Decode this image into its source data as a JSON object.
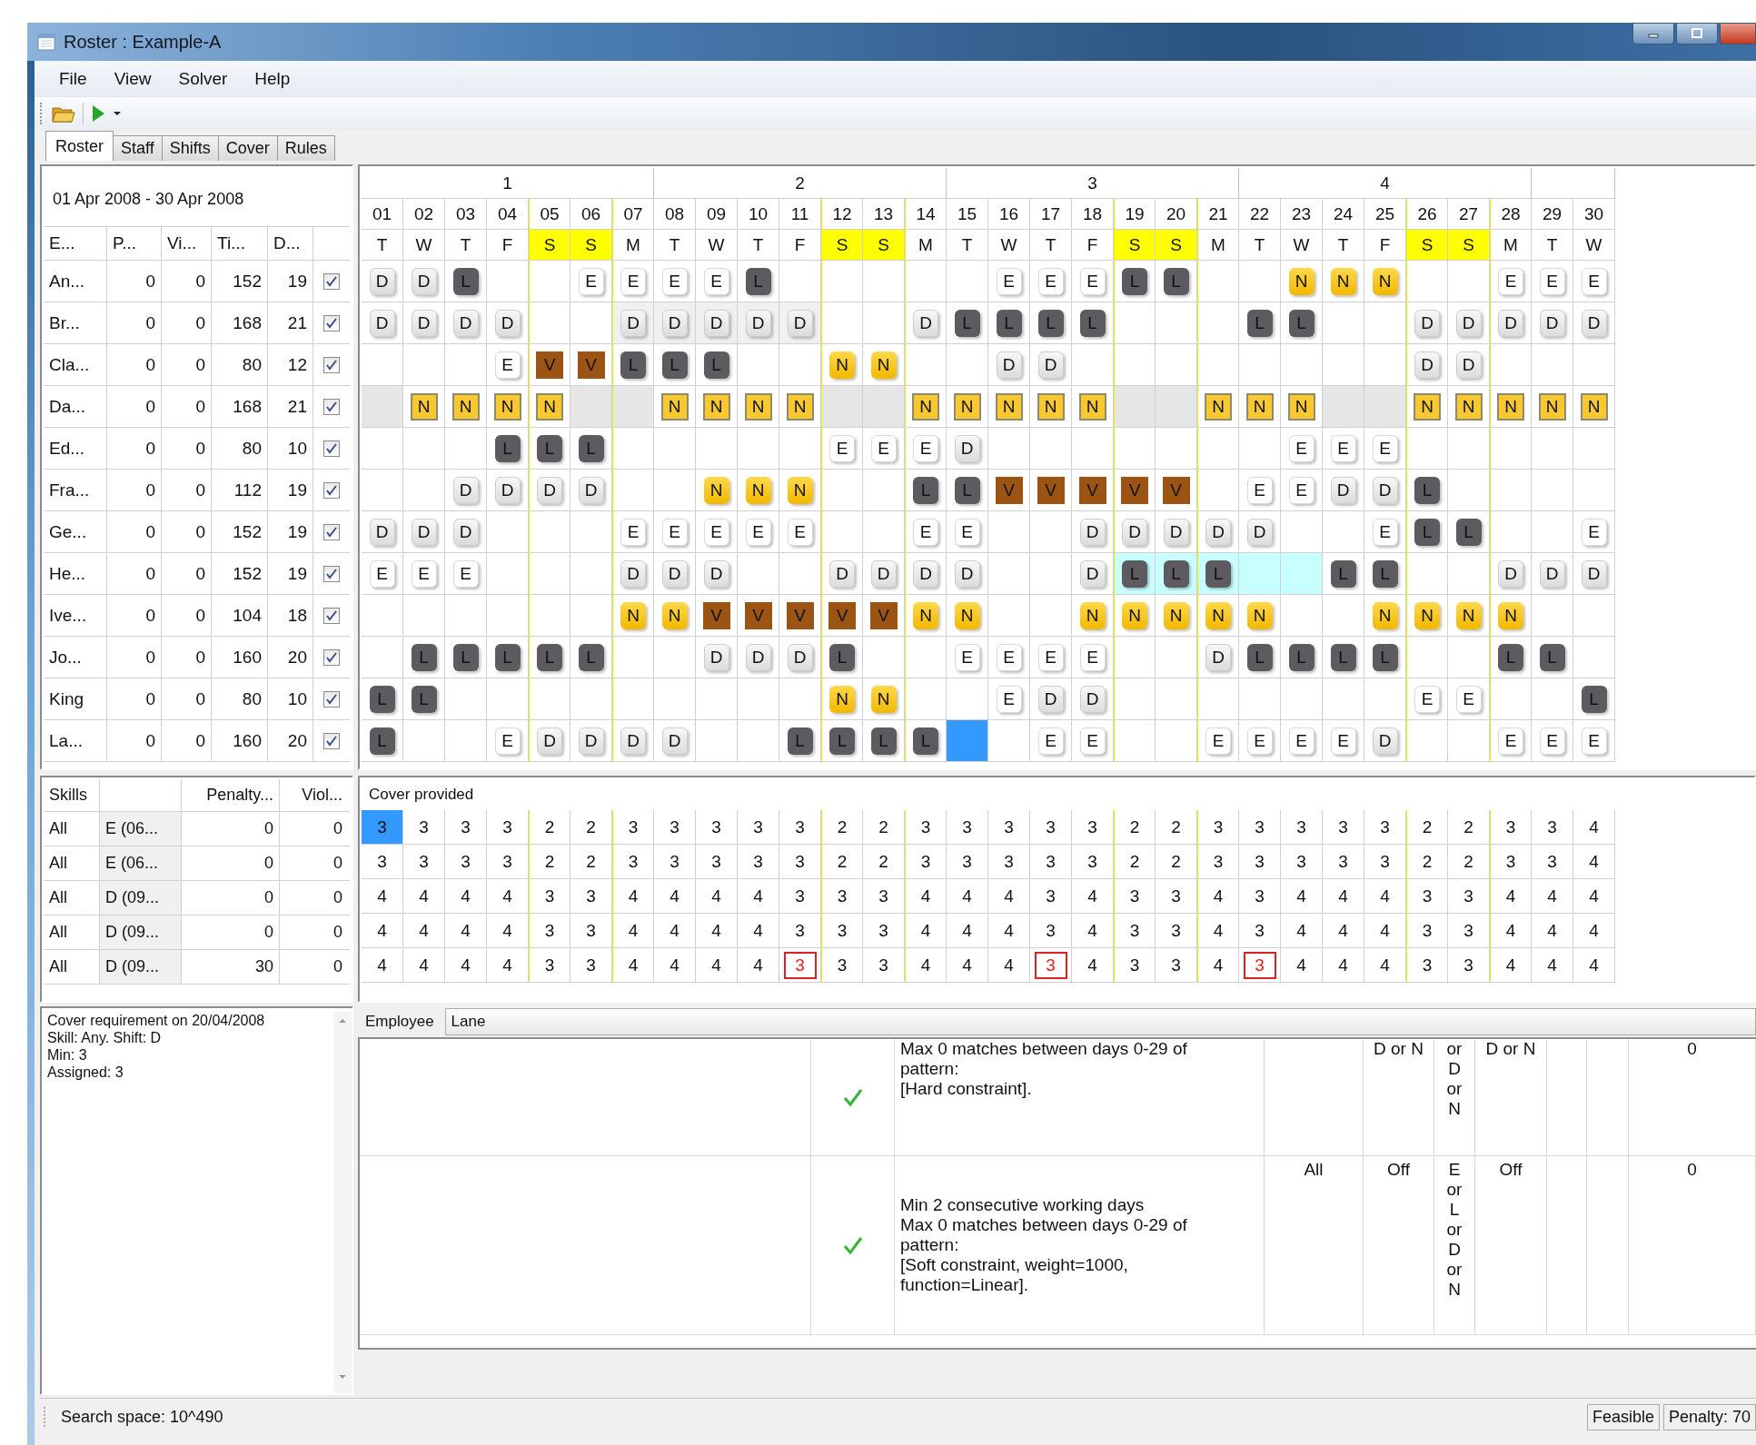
{
  "window": {
    "title": "Roster : Example-A"
  },
  "menu": [
    "File",
    "View",
    "Solver",
    "Help"
  ],
  "tabs": [
    {
      "label": "Roster",
      "selected": true
    },
    {
      "label": "Staff",
      "selected": false
    },
    {
      "label": "Shifts",
      "selected": false
    },
    {
      "label": "Cover",
      "selected": false
    },
    {
      "label": "Rules",
      "selected": false
    }
  ],
  "staff": {
    "date_range": "01 Apr 2008 - 30 Apr 2008",
    "columns": [
      "E...",
      "P...",
      "Vi...",
      "Ti...",
      "D..."
    ],
    "rows": [
      {
        "cells": [
          "An...",
          "0",
          "0",
          "152",
          "19"
        ],
        "checked": true
      },
      {
        "cells": [
          "Br...",
          "0",
          "0",
          "168",
          "21"
        ],
        "checked": true
      },
      {
        "cells": [
          "Cla...",
          "0",
          "0",
          "80",
          "12"
        ],
        "checked": true
      },
      {
        "cells": [
          "Da...",
          "0",
          "0",
          "168",
          "21"
        ],
        "checked": true
      },
      {
        "cells": [
          "Ed...",
          "0",
          "0",
          "80",
          "10"
        ],
        "checked": true
      },
      {
        "cells": [
          "Fra...",
          "0",
          "0",
          "112",
          "19"
        ],
        "checked": true
      },
      {
        "cells": [
          "Ge...",
          "0",
          "0",
          "152",
          "19"
        ],
        "checked": true
      },
      {
        "cells": [
          "He...",
          "0",
          "0",
          "152",
          "19"
        ],
        "checked": true
      },
      {
        "cells": [
          "Ive...",
          "0",
          "0",
          "104",
          "18"
        ],
        "checked": true
      },
      {
        "cells": [
          "Jo...",
          "0",
          "0",
          "160",
          "20"
        ],
        "checked": true
      },
      {
        "cells": [
          "King",
          "0",
          "0",
          "80",
          "10"
        ],
        "checked": true
      },
      {
        "cells": [
          "La...",
          "0",
          "0",
          "160",
          "20"
        ],
        "checked": true
      }
    ]
  },
  "roster": {
    "weeks": [
      "1",
      "2",
      "3",
      "4"
    ],
    "days": [
      {
        "num": "01",
        "dow": "T",
        "weekend": false
      },
      {
        "num": "02",
        "dow": "W",
        "weekend": false
      },
      {
        "num": "03",
        "dow": "T",
        "weekend": false
      },
      {
        "num": "04",
        "dow": "F",
        "weekend": false
      },
      {
        "num": "05",
        "dow": "S",
        "weekend": true
      },
      {
        "num": "06",
        "dow": "S",
        "weekend": true
      },
      {
        "num": "07",
        "dow": "M",
        "weekend": false
      },
      {
        "num": "08",
        "dow": "T",
        "weekend": false
      },
      {
        "num": "09",
        "dow": "W",
        "weekend": false
      },
      {
        "num": "10",
        "dow": "T",
        "weekend": false
      },
      {
        "num": "11",
        "dow": "F",
        "weekend": false
      },
      {
        "num": "12",
        "dow": "S",
        "weekend": true
      },
      {
        "num": "13",
        "dow": "S",
        "weekend": true
      },
      {
        "num": "14",
        "dow": "M",
        "weekend": false
      },
      {
        "num": "15",
        "dow": "T",
        "weekend": false
      },
      {
        "num": "16",
        "dow": "W",
        "weekend": false
      },
      {
        "num": "17",
        "dow": "T",
        "weekend": false
      },
      {
        "num": "18",
        "dow": "F",
        "weekend": false
      },
      {
        "num": "19",
        "dow": "S",
        "weekend": true
      },
      {
        "num": "20",
        "dow": "S",
        "weekend": true
      },
      {
        "num": "21",
        "dow": "M",
        "weekend": false
      },
      {
        "num": "22",
        "dow": "T",
        "weekend": false
      },
      {
        "num": "23",
        "dow": "W",
        "weekend": false
      },
      {
        "num": "24",
        "dow": "T",
        "weekend": false
      },
      {
        "num": "25",
        "dow": "F",
        "weekend": false
      },
      {
        "num": "26",
        "dow": "S",
        "weekend": true
      },
      {
        "num": "27",
        "dow": "S",
        "weekend": true
      },
      {
        "num": "28",
        "dow": "M",
        "weekend": false
      },
      {
        "num": "29",
        "dow": "T",
        "weekend": false
      },
      {
        "num": "30",
        "dow": "W",
        "weekend": false
      }
    ],
    "rows": [
      {
        "cells": [
          {
            "shift": "D",
            "kind": "day"
          },
          {
            "shift": "D",
            "kind": "day"
          },
          {
            "shift": "L",
            "kind": "late"
          },
          null,
          null,
          {
            "shift": "E",
            "kind": "early"
          },
          {
            "shift": "E",
            "kind": "early"
          },
          {
            "shift": "E",
            "kind": "early"
          },
          {
            "shift": "E",
            "kind": "early"
          },
          {
            "shift": "L",
            "kind": "late"
          },
          null,
          null,
          null,
          null,
          null,
          {
            "shift": "E",
            "kind": "early"
          },
          {
            "shift": "E",
            "kind": "early"
          },
          {
            "shift": "E",
            "kind": "early"
          },
          {
            "shift": "L",
            "kind": "late"
          },
          {
            "shift": "L",
            "kind": "late"
          },
          null,
          null,
          {
            "shift": "N",
            "kind": "night"
          },
          {
            "shift": "N",
            "kind": "night"
          },
          {
            "shift": "N",
            "kind": "night"
          },
          null,
          null,
          {
            "shift": "E",
            "kind": "early"
          },
          {
            "shift": "E",
            "kind": "early"
          },
          {
            "shift": "E",
            "kind": "early"
          }
        ]
      },
      {
        "cells": [
          {
            "shift": "D",
            "kind": "day"
          },
          {
            "shift": "D",
            "kind": "day"
          },
          {
            "shift": "D",
            "kind": "day"
          },
          {
            "shift": "D",
            "kind": "day"
          },
          null,
          null,
          {
            "shift": "D",
            "kind": "day",
            "color": "#f0f0f0"
          },
          {
            "shift": "D",
            "kind": "day",
            "color": "#f0f0f0"
          },
          {
            "shift": "D",
            "kind": "day",
            "color": "#f0f0f0"
          },
          {
            "shift": "D",
            "kind": "day",
            "color": "#f0f0f0"
          },
          {
            "shift": "D",
            "kind": "day",
            "color": "#f0f0f0"
          },
          null,
          null,
          {
            "shift": "D",
            "kind": "day"
          },
          {
            "shift": "L",
            "kind": "late"
          },
          {
            "shift": "L",
            "kind": "late"
          },
          {
            "shift": "L",
            "kind": "late"
          },
          {
            "shift": "L",
            "kind": "late"
          },
          null,
          null,
          null,
          {
            "shift": "L",
            "kind": "late"
          },
          {
            "shift": "L",
            "kind": "late"
          },
          null,
          null,
          {
            "shift": "D",
            "kind": "day"
          },
          {
            "shift": "D",
            "kind": "day"
          },
          {
            "shift": "D",
            "kind": "day"
          },
          {
            "shift": "D",
            "kind": "day"
          },
          {
            "shift": "D",
            "kind": "day"
          }
        ]
      },
      {
        "cells": [
          null,
          null,
          null,
          {
            "shift": "E",
            "kind": "early"
          },
          {
            "shift": "V",
            "kind": "vacation"
          },
          {
            "shift": "V",
            "kind": "vacation"
          },
          {
            "shift": "L",
            "kind": "late"
          },
          {
            "shift": "L",
            "kind": "late"
          },
          {
            "shift": "L",
            "kind": "late"
          },
          null,
          null,
          {
            "shift": "N",
            "kind": "night"
          },
          {
            "shift": "N",
            "kind": "night"
          },
          null,
          null,
          {
            "shift": "D",
            "kind": "day"
          },
          {
            "shift": "D",
            "kind": "day"
          },
          null,
          null,
          null,
          null,
          null,
          null,
          null,
          null,
          {
            "shift": "D",
            "kind": "day"
          },
          {
            "shift": "D",
            "kind": "day"
          },
          null,
          null,
          null
        ]
      },
      {
        "cells": [
          {
            "color": "#e6e6e6"
          },
          {
            "shift": "N",
            "kind": "locked"
          },
          {
            "shift": "N",
            "kind": "locked"
          },
          {
            "shift": "N",
            "kind": "locked"
          },
          {
            "shift": "N",
            "kind": "locked"
          },
          {
            "color": "#e6e6e6"
          },
          {
            "color": "#e6e6e6"
          },
          {
            "shift": "N",
            "kind": "locked"
          },
          {
            "shift": "N",
            "kind": "locked"
          },
          {
            "shift": "N",
            "kind": "locked"
          },
          {
            "shift": "N",
            "kind": "locked"
          },
          {
            "color": "#e6e6e6"
          },
          {
            "color": "#e6e6e6"
          },
          {
            "shift": "N",
            "kind": "locked"
          },
          {
            "shift": "N",
            "kind": "locked"
          },
          {
            "shift": "N",
            "kind": "locked"
          },
          {
            "shift": "N",
            "kind": "locked"
          },
          {
            "shift": "N",
            "kind": "locked"
          },
          {
            "color": "#e6e6e6"
          },
          {
            "color": "#e6e6e6"
          },
          {
            "shift": "N",
            "kind": "locked"
          },
          {
            "shift": "N",
            "kind": "locked"
          },
          {
            "shift": "N",
            "kind": "locked"
          },
          {
            "color": "#e6e6e6"
          },
          {
            "color": "#e6e6e6"
          },
          {
            "shift": "N",
            "kind": "locked"
          },
          {
            "shift": "N",
            "kind": "locked"
          },
          {
            "shift": "N",
            "kind": "locked"
          },
          {
            "shift": "N",
            "kind": "locked"
          },
          {
            "shift": "N",
            "kind": "locked"
          }
        ]
      },
      {
        "cells": [
          null,
          null,
          null,
          {
            "shift": "L",
            "kind": "late"
          },
          {
            "shift": "L",
            "kind": "late"
          },
          {
            "shift": "L",
            "kind": "late"
          },
          null,
          null,
          null,
          null,
          null,
          {
            "shift": "E",
            "kind": "early"
          },
          {
            "shift": "E",
            "kind": "early"
          },
          {
            "shift": "E",
            "kind": "early"
          },
          {
            "shift": "D",
            "kind": "day"
          },
          null,
          null,
          null,
          null,
          null,
          null,
          null,
          {
            "shift": "E",
            "kind": "early"
          },
          {
            "shift": "E",
            "kind": "early"
          },
          {
            "shift": "E",
            "kind": "early"
          },
          null,
          null,
          null,
          null,
          null
        ]
      },
      {
        "cells": [
          null,
          null,
          {
            "shift": "D",
            "kind": "day"
          },
          {
            "shift": "D",
            "kind": "day"
          },
          {
            "shift": "D",
            "kind": "day"
          },
          {
            "shift": "D",
            "kind": "day"
          },
          null,
          null,
          {
            "shift": "N",
            "kind": "night"
          },
          {
            "shift": "N",
            "kind": "night"
          },
          {
            "shift": "N",
            "kind": "night"
          },
          null,
          null,
          {
            "shift": "L",
            "kind": "late"
          },
          {
            "shift": "L",
            "kind": "late"
          },
          {
            "shift": "V",
            "kind": "vacation"
          },
          {
            "shift": "V",
            "kind": "vacation"
          },
          {
            "shift": "V",
            "kind": "vacation"
          },
          {
            "shift": "V",
            "kind": "vacation"
          },
          {
            "shift": "V",
            "kind": "vacation"
          },
          null,
          {
            "shift": "E",
            "kind": "early"
          },
          {
            "shift": "E",
            "kind": "early"
          },
          {
            "shift": "D",
            "kind": "day"
          },
          {
            "shift": "D",
            "kind": "day"
          },
          {
            "shift": "L",
            "kind": "late"
          },
          null,
          null,
          null,
          null
        ]
      },
      {
        "cells": [
          {
            "shift": "D",
            "kind": "day"
          },
          {
            "shift": "D",
            "kind": "day"
          },
          {
            "shift": "D",
            "kind": "day"
          },
          null,
          null,
          null,
          {
            "shift": "E",
            "kind": "early"
          },
          {
            "shift": "E",
            "kind": "early"
          },
          {
            "shift": "E",
            "kind": "early"
          },
          {
            "shift": "E",
            "kind": "early"
          },
          {
            "shift": "E",
            "kind": "early"
          },
          null,
          null,
          {
            "shift": "E",
            "kind": "early"
          },
          {
            "shift": "E",
            "kind": "early"
          },
          null,
          null,
          {
            "shift": "D",
            "kind": "day"
          },
          {
            "shift": "D",
            "kind": "day"
          },
          {
            "shift": "D",
            "kind": "day"
          },
          {
            "shift": "D",
            "kind": "day"
          },
          {
            "shift": "D",
            "kind": "day"
          },
          null,
          null,
          {
            "shift": "E",
            "kind": "early"
          },
          {
            "shift": "L",
            "kind": "late"
          },
          {
            "shift": "L",
            "kind": "late"
          },
          null,
          null,
          {
            "shift": "E",
            "kind": "early"
          }
        ]
      },
      {
        "cells": [
          {
            "shift": "E",
            "kind": "early"
          },
          {
            "shift": "E",
            "kind": "early"
          },
          {
            "shift": "E",
            "kind": "early"
          },
          null,
          null,
          null,
          {
            "shift": "D",
            "kind": "day"
          },
          {
            "shift": "D",
            "kind": "day"
          },
          {
            "shift": "D",
            "kind": "day"
          },
          null,
          null,
          {
            "shift": "D",
            "kind": "day"
          },
          {
            "shift": "D",
            "kind": "day"
          },
          {
            "shift": "D",
            "kind": "day"
          },
          {
            "shift": "D",
            "kind": "day"
          },
          null,
          null,
          {
            "shift": "D",
            "kind": "day"
          },
          {
            "shift": "L",
            "kind": "late",
            "color": "#c8ffff"
          },
          {
            "shift": "L",
            "kind": "late",
            "color": "#c8ffff"
          },
          {
            "shift": "L",
            "kind": "late",
            "color": "#c8ffff"
          },
          {
            "color": "#c8ffff"
          },
          {
            "color": "#c8ffff"
          },
          {
            "shift": "L",
            "kind": "late"
          },
          {
            "shift": "L",
            "kind": "late"
          },
          null,
          null,
          {
            "shift": "D",
            "kind": "day"
          },
          {
            "shift": "D",
            "kind": "day"
          },
          {
            "shift": "D",
            "kind": "day"
          }
        ]
      },
      {
        "cells": [
          null,
          null,
          null,
          null,
          null,
          null,
          {
            "shift": "N",
            "kind": "night"
          },
          {
            "shift": "N",
            "kind": "night"
          },
          {
            "shift": "V",
            "kind": "vacation"
          },
          {
            "shift": "V",
            "kind": "vacation"
          },
          {
            "shift": "V",
            "kind": "vacation"
          },
          {
            "shift": "V",
            "kind": "vacation"
          },
          {
            "shift": "V",
            "kind": "vacation"
          },
          {
            "shift": "N",
            "kind": "night"
          },
          {
            "shift": "N",
            "kind": "night"
          },
          null,
          null,
          {
            "shift": "N",
            "kind": "night"
          },
          {
            "shift": "N",
            "kind": "night"
          },
          {
            "shift": "N",
            "kind": "night"
          },
          {
            "shift": "N",
            "kind": "night"
          },
          {
            "shift": "N",
            "kind": "night"
          },
          null,
          null,
          {
            "shift": "N",
            "kind": "night"
          },
          {
            "shift": "N",
            "kind": "night"
          },
          {
            "shift": "N",
            "kind": "night"
          },
          {
            "shift": "N",
            "kind": "night"
          },
          null,
          null
        ]
      },
      {
        "cells": [
          null,
          {
            "shift": "L",
            "kind": "late"
          },
          {
            "shift": "L",
            "kind": "late"
          },
          {
            "shift": "L",
            "kind": "late"
          },
          {
            "shift": "L",
            "kind": "late"
          },
          {
            "shift": "L",
            "kind": "late"
          },
          null,
          null,
          {
            "shift": "D",
            "kind": "day"
          },
          {
            "shift": "D",
            "kind": "day"
          },
          {
            "shift": "D",
            "kind": "day"
          },
          {
            "shift": "L",
            "kind": "late"
          },
          null,
          null,
          {
            "shift": "E",
            "kind": "early"
          },
          {
            "shift": "E",
            "kind": "early"
          },
          {
            "shift": "E",
            "kind": "early"
          },
          {
            "shift": "E",
            "kind": "early"
          },
          null,
          null,
          {
            "shift": "D",
            "kind": "day"
          },
          {
            "shift": "L",
            "kind": "late"
          },
          {
            "shift": "L",
            "kind": "late"
          },
          {
            "shift": "L",
            "kind": "late"
          },
          {
            "shift": "L",
            "kind": "late"
          },
          null,
          null,
          {
            "shift": "L",
            "kind": "late"
          },
          {
            "shift": "L",
            "kind": "late"
          },
          null
        ]
      },
      {
        "cells": [
          {
            "shift": "L",
            "kind": "late"
          },
          {
            "shift": "L",
            "kind": "late"
          },
          null,
          null,
          null,
          null,
          null,
          null,
          null,
          null,
          null,
          {
            "shift": "N",
            "kind": "night"
          },
          {
            "shift": "N",
            "kind": "night"
          },
          null,
          null,
          {
            "shift": "E",
            "kind": "early"
          },
          {
            "shift": "D",
            "kind": "day"
          },
          {
            "shift": "D",
            "kind": "day"
          },
          null,
          null,
          null,
          null,
          null,
          null,
          null,
          {
            "shift": "E",
            "kind": "early"
          },
          {
            "shift": "E",
            "kind": "early"
          },
          null,
          null,
          {
            "shift": "L",
            "kind": "late"
          }
        ]
      },
      {
        "cells": [
          {
            "shift": "L",
            "kind": "late"
          },
          null,
          null,
          {
            "shift": "E",
            "kind": "early"
          },
          {
            "shift": "D",
            "kind": "day"
          },
          {
            "shift": "D",
            "kind": "day"
          },
          {
            "shift": "D",
            "kind": "day"
          },
          {
            "shift": "D",
            "kind": "day"
          },
          null,
          null,
          {
            "shift": "L",
            "kind": "late"
          },
          {
            "shift": "L",
            "kind": "late"
          },
          {
            "shift": "L",
            "kind": "late"
          },
          {
            "shift": "L",
            "kind": "late"
          },
          {
            "color": "#3399ff"
          },
          null,
          {
            "shift": "E",
            "kind": "early"
          },
          {
            "shift": "E",
            "kind": "early"
          },
          null,
          null,
          {
            "shift": "E",
            "kind": "early"
          },
          {
            "shift": "E",
            "kind": "early"
          },
          {
            "shift": "E",
            "kind": "early"
          },
          {
            "shift": "E",
            "kind": "early"
          },
          {
            "shift": "D",
            "kind": "day"
          },
          null,
          null,
          {
            "shift": "E",
            "kind": "early"
          },
          {
            "shift": "E",
            "kind": "early"
          },
          {
            "shift": "E",
            "kind": "early"
          }
        ]
      }
    ]
  },
  "cover": {
    "columns": [
      "Skills",
      "Penalty...",
      "Viol..."
    ],
    "title": "Cover provided",
    "rows": [
      {
        "skill": "All",
        "shift": "E (06...",
        "penalty": "0",
        "violations": "0",
        "cells": [
          {
            "value": "3",
            "selected": true
          },
          {
            "value": "3"
          },
          {
            "value": "3"
          },
          {
            "value": "3"
          },
          {
            "value": "2"
          },
          {
            "value": "2"
          },
          {
            "value": "3"
          },
          {
            "value": "3"
          },
          {
            "value": "3"
          },
          {
            "value": "3"
          },
          {
            "value": "3"
          },
          {
            "value": "2"
          },
          {
            "value": "2"
          },
          {
            "value": "3"
          },
          {
            "value": "3"
          },
          {
            "value": "3"
          },
          {
            "value": "3"
          },
          {
            "value": "3"
          },
          {
            "value": "2"
          },
          {
            "value": "2"
          },
          {
            "value": "3"
          },
          {
            "value": "3"
          },
          {
            "value": "3"
          },
          {
            "value": "3"
          },
          {
            "value": "3"
          },
          {
            "value": "2"
          },
          {
            "value": "2"
          },
          {
            "value": "3"
          },
          {
            "value": "3"
          },
          {
            "value": "4"
          }
        ]
      },
      {
        "skill": "All",
        "shift": "E (06...",
        "penalty": "0",
        "violations": "0",
        "cells": [
          {
            "value": "3"
          },
          {
            "value": "3"
          },
          {
            "value": "3"
          },
          {
            "value": "3"
          },
          {
            "value": "2"
          },
          {
            "value": "2"
          },
          {
            "value": "3"
          },
          {
            "value": "3"
          },
          {
            "value": "3"
          },
          {
            "value": "3"
          },
          {
            "value": "3"
          },
          {
            "value": "2"
          },
          {
            "value": "2"
          },
          {
            "value": "3"
          },
          {
            "value": "3"
          },
          {
            "value": "3"
          },
          {
            "value": "3"
          },
          {
            "value": "3"
          },
          {
            "value": "2"
          },
          {
            "value": "2"
          },
          {
            "value": "3"
          },
          {
            "value": "3"
          },
          {
            "value": "3"
          },
          {
            "value": "3"
          },
          {
            "value": "3"
          },
          {
            "value": "2"
          },
          {
            "value": "2"
          },
          {
            "value": "3"
          },
          {
            "value": "3"
          },
          {
            "value": "4"
          }
        ]
      },
      {
        "skill": "All",
        "shift": "D (09...",
        "penalty": "0",
        "violations": "0",
        "cells": [
          {
            "value": "4"
          },
          {
            "value": "4"
          },
          {
            "value": "4"
          },
          {
            "value": "4"
          },
          {
            "value": "3"
          },
          {
            "value": "3"
          },
          {
            "value": "4"
          },
          {
            "value": "4"
          },
          {
            "value": "4"
          },
          {
            "value": "4"
          },
          {
            "value": "3"
          },
          {
            "value": "3"
          },
          {
            "value": "3"
          },
          {
            "value": "4"
          },
          {
            "value": "4"
          },
          {
            "value": "4"
          },
          {
            "value": "3"
          },
          {
            "value": "4"
          },
          {
            "value": "3"
          },
          {
            "value": "3"
          },
          {
            "value": "4"
          },
          {
            "value": "3"
          },
          {
            "value": "4"
          },
          {
            "value": "4"
          },
          {
            "value": "4"
          },
          {
            "value": "3"
          },
          {
            "value": "3"
          },
          {
            "value": "4"
          },
          {
            "value": "4"
          },
          {
            "value": "4"
          }
        ]
      },
      {
        "skill": "All",
        "shift": "D (09...",
        "penalty": "0",
        "violations": "0",
        "cells": [
          {
            "value": "4"
          },
          {
            "value": "4"
          },
          {
            "value": "4"
          },
          {
            "value": "4"
          },
          {
            "value": "3"
          },
          {
            "value": "3"
          },
          {
            "value": "4"
          },
          {
            "value": "4"
          },
          {
            "value": "4"
          },
          {
            "value": "4"
          },
          {
            "value": "3"
          },
          {
            "value": "3"
          },
          {
            "value": "3"
          },
          {
            "value": "4"
          },
          {
            "value": "4"
          },
          {
            "value": "4"
          },
          {
            "value": "3"
          },
          {
            "value": "4"
          },
          {
            "value": "3"
          },
          {
            "value": "3"
          },
          {
            "value": "4"
          },
          {
            "value": "3"
          },
          {
            "value": "4"
          },
          {
            "value": "4"
          },
          {
            "value": "4"
          },
          {
            "value": "3"
          },
          {
            "value": "3"
          },
          {
            "value": "4"
          },
          {
            "value": "4"
          },
          {
            "value": "4"
          }
        ]
      },
      {
        "skill": "All",
        "shift": "D (09...",
        "penalty": "30",
        "violations": "0",
        "cells": [
          {
            "value": "4"
          },
          {
            "value": "4"
          },
          {
            "value": "4"
          },
          {
            "value": "4"
          },
          {
            "value": "3"
          },
          {
            "value": "3"
          },
          {
            "value": "4"
          },
          {
            "value": "4"
          },
          {
            "value": "4"
          },
          {
            "value": "4"
          },
          {
            "value": "3",
            "short": true
          },
          {
            "value": "3"
          },
          {
            "value": "3"
          },
          {
            "value": "4"
          },
          {
            "value": "4"
          },
          {
            "value": "4"
          },
          {
            "value": "3",
            "short": true
          },
          {
            "value": "4"
          },
          {
            "value": "3"
          },
          {
            "value": "3"
          },
          {
            "value": "4"
          },
          {
            "value": "3",
            "short": true
          },
          {
            "value": "4"
          },
          {
            "value": "4"
          },
          {
            "value": "4"
          },
          {
            "value": "3"
          },
          {
            "value": "3"
          },
          {
            "value": "4"
          },
          {
            "value": "4"
          },
          {
            "value": "4"
          }
        ]
      }
    ]
  },
  "info": {
    "lines": [
      "Cover requirement on 20/04/2008",
      "Skill: Any. Shift: D",
      "Min: 3",
      "Assigned: 3"
    ]
  },
  "rules": {
    "employee_label": "Employee",
    "employee": "Lane",
    "rows": [
      {
        "text": "Max 0 matches between days 0-29 of pattern:\n[Hard constraint].",
        "cells": [
          null,
          "D or N",
          "or D or N",
          "D or N",
          null,
          null,
          "0"
        ]
      },
      {
        "text": "Min 2 consecutive working days\nMax 0 matches between days 0-29 of pattern:\n[Soft constraint, weight=1000, function=Linear].",
        "cells": [
          "All",
          "Off",
          "E or L or D or N",
          "Off",
          null,
          null,
          "0"
        ]
      }
    ]
  },
  "status_bar": {
    "search_space": "Search space: 10^490",
    "state": "Feasible",
    "penalty": "Penalty: 70"
  }
}
